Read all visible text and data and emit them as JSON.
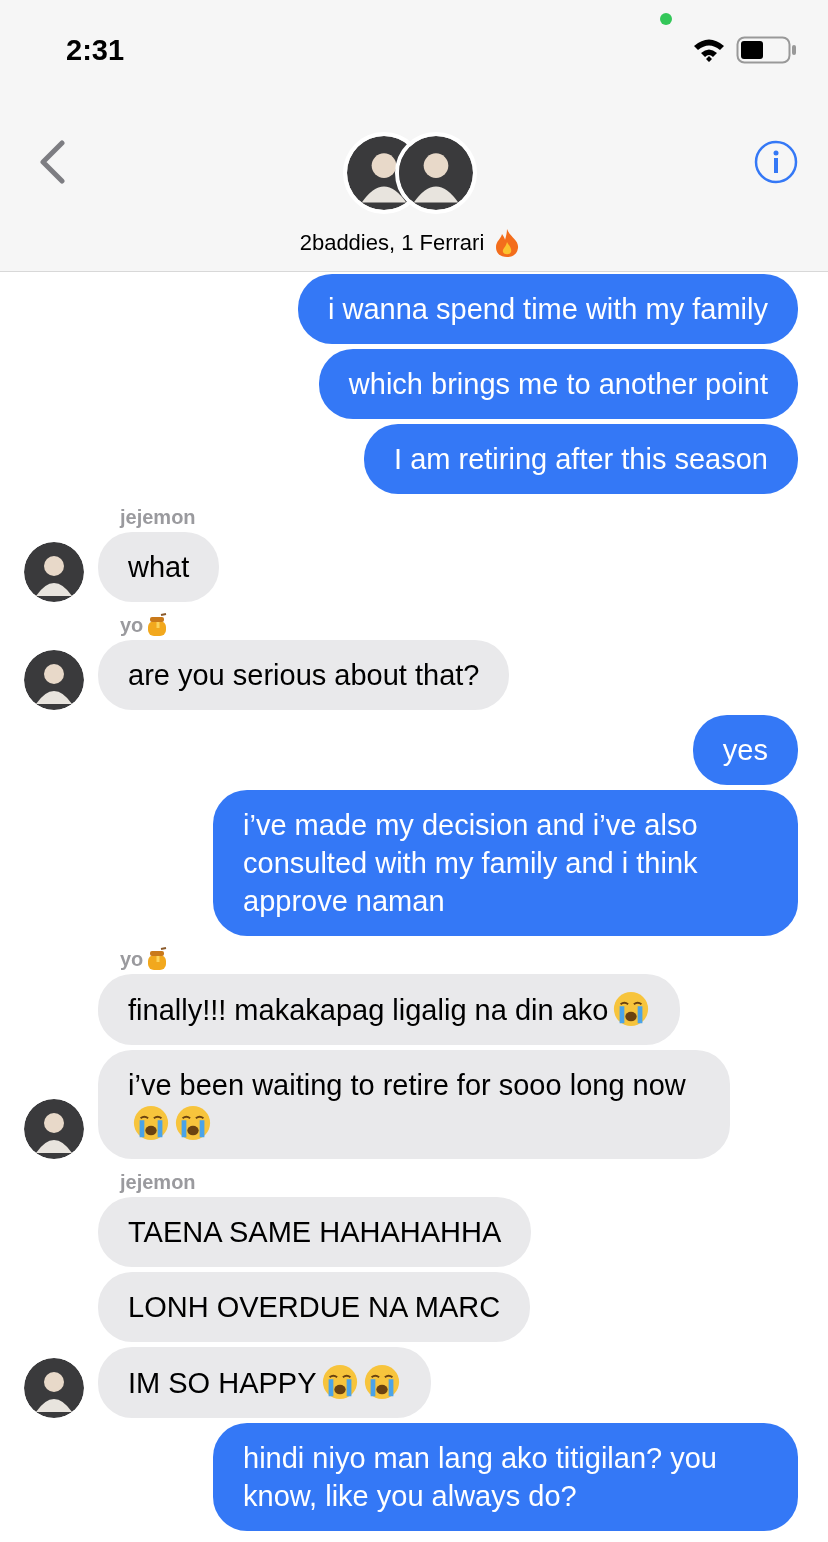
{
  "status_bar": {
    "time": "2:31"
  },
  "header": {
    "title": "2baddies, 1 Ferrari"
  },
  "messages": [
    {
      "kind": "sent",
      "parts": [
        {
          "kind": "text",
          "text": "i wanna spend time with my family"
        }
      ]
    },
    {
      "kind": "sent",
      "parts": [
        {
          "kind": "text",
          "text": "which brings me to another point"
        }
      ]
    },
    {
      "kind": "sent",
      "parts": [
        {
          "kind": "text",
          "text": "I am retiring after this season"
        }
      ]
    },
    {
      "kind": "received",
      "sender": "jejemon",
      "sender_icon": false,
      "avatar": true,
      "parts": [
        {
          "kind": "text",
          "text": "what"
        }
      ]
    },
    {
      "kind": "received",
      "sender": "yo",
      "sender_icon": true,
      "avatar": true,
      "parts": [
        {
          "kind": "text",
          "text": "are you serious about that?"
        }
      ]
    },
    {
      "kind": "sent",
      "parts": [
        {
          "kind": "text",
          "text": "yes"
        }
      ]
    },
    {
      "kind": "sent",
      "parts": [
        {
          "kind": "text",
          "text": "i’ve made my decision and i’ve also consulted with my family and i think approve naman"
        }
      ]
    },
    {
      "kind": "received",
      "sender": "yo",
      "sender_icon": true,
      "avatar": false,
      "parts": [
        {
          "kind": "text",
          "text": "finally!!! makakapag ligalig na din ako"
        },
        {
          "kind": "crying-face"
        }
      ]
    },
    {
      "kind": "received",
      "avatar": true,
      "parts": [
        {
          "kind": "text",
          "text": "i’ve been waiting to retire for sooo long now"
        },
        {
          "kind": "crying-face"
        },
        {
          "kind": "crying-face"
        }
      ]
    },
    {
      "kind": "received",
      "sender": "jejemon",
      "sender_icon": false,
      "avatar": false,
      "parts": [
        {
          "kind": "text",
          "text": "TAENA SAME HAHAHAHHA"
        }
      ]
    },
    {
      "kind": "received",
      "avatar": false,
      "parts": [
        {
          "kind": "text",
          "text": "LONH OVERDUE NA MARC"
        }
      ]
    },
    {
      "kind": "received",
      "avatar": true,
      "parts": [
        {
          "kind": "text",
          "text": "IM SO HAPPY"
        },
        {
          "kind": "crying-face"
        },
        {
          "kind": "crying-face"
        }
      ]
    },
    {
      "kind": "sent",
      "parts": [
        {
          "kind": "text",
          "text": "hindi niyo man lang ako titigilan? you know, like you always do?"
        }
      ]
    }
  ]
}
